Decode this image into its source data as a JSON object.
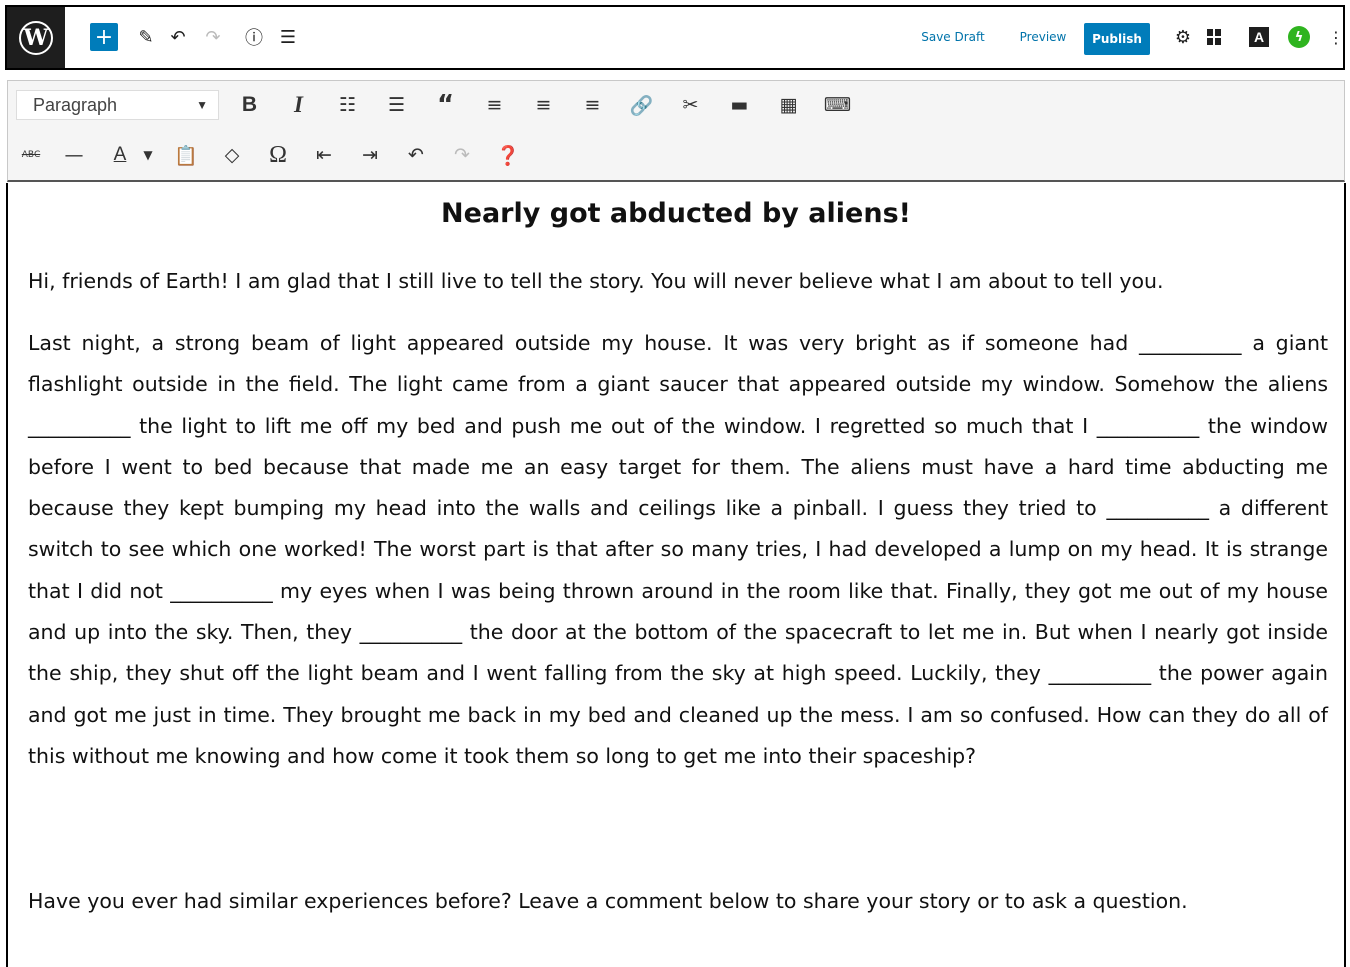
{
  "topbar": {
    "logo_glyph": "W",
    "add_block_glyph": "+",
    "save_draft": "Save Draft",
    "preview": "Preview",
    "publish": "Publish",
    "icons": [
      "wordpress-logo",
      "add-block",
      "edit-pencil",
      "undo",
      "redo",
      "info",
      "outline-list",
      "settings-gear",
      "blocks-grid",
      "amp-a",
      "jetpack",
      "more-options"
    ]
  },
  "classic_toolbar": {
    "format_select_value": "Paragraph",
    "row1_icons": [
      "bold",
      "italic",
      "bulleted-list",
      "numbered-list",
      "blockquote",
      "align-left",
      "align-center",
      "align-right",
      "insert-link",
      "remove-link",
      "read-more",
      "toggle-toolbar",
      "keyboard"
    ],
    "row2_icons": [
      "strikethrough",
      "horizontal-line",
      "text-color",
      "paste-as-text",
      "clear-formatting",
      "special-character",
      "outdent",
      "indent",
      "undo",
      "redo",
      "help"
    ]
  },
  "post": {
    "title": "Nearly got abducted by aliens!",
    "paragraphs": [
      "Hi, friends of Earth! I am glad that I still live to tell the story. You will never believe what I am about to tell you.",
      "Last night, a strong beam of light appeared outside my house. It was very bright as if someone had __________ a giant flashlight outside in the field. The light came from a giant saucer that appeared outside my window. Somehow the aliens __________ the light to lift me off my bed and push me out of the window. I regretted so much that I __________ the window before I went to bed because that made me an easy target for them. The aliens must have a hard time abducting me because they kept bumping my head into the walls and ceilings like a pinball. I guess they tried to __________ a different switch to see which one worked! The worst part is that after so many tries, I had developed a lump on my head. It is strange that I did not __________ my eyes when I was being thrown around in the room like that. Finally, they got me out of my house and up into the sky. Then, they __________ the door at the bottom of the spacecraft to let me in. But when I nearly got inside the ship, they shut off the light beam and I went falling from the sky at high speed. Luckily, they __________ the power again and got me just in time. They brought me back in my bed and cleaned up the mess. I am so confused. How can they do all of this without me knowing and how come it took them so long to get me into their spaceship?",
      "Have you ever had similar experiences before? Leave a comment below to share your story or to ask a question."
    ]
  },
  "colors": {
    "accent": "#007cba",
    "jetpack": "#2fb41f",
    "dark": "#1e1e1e"
  }
}
